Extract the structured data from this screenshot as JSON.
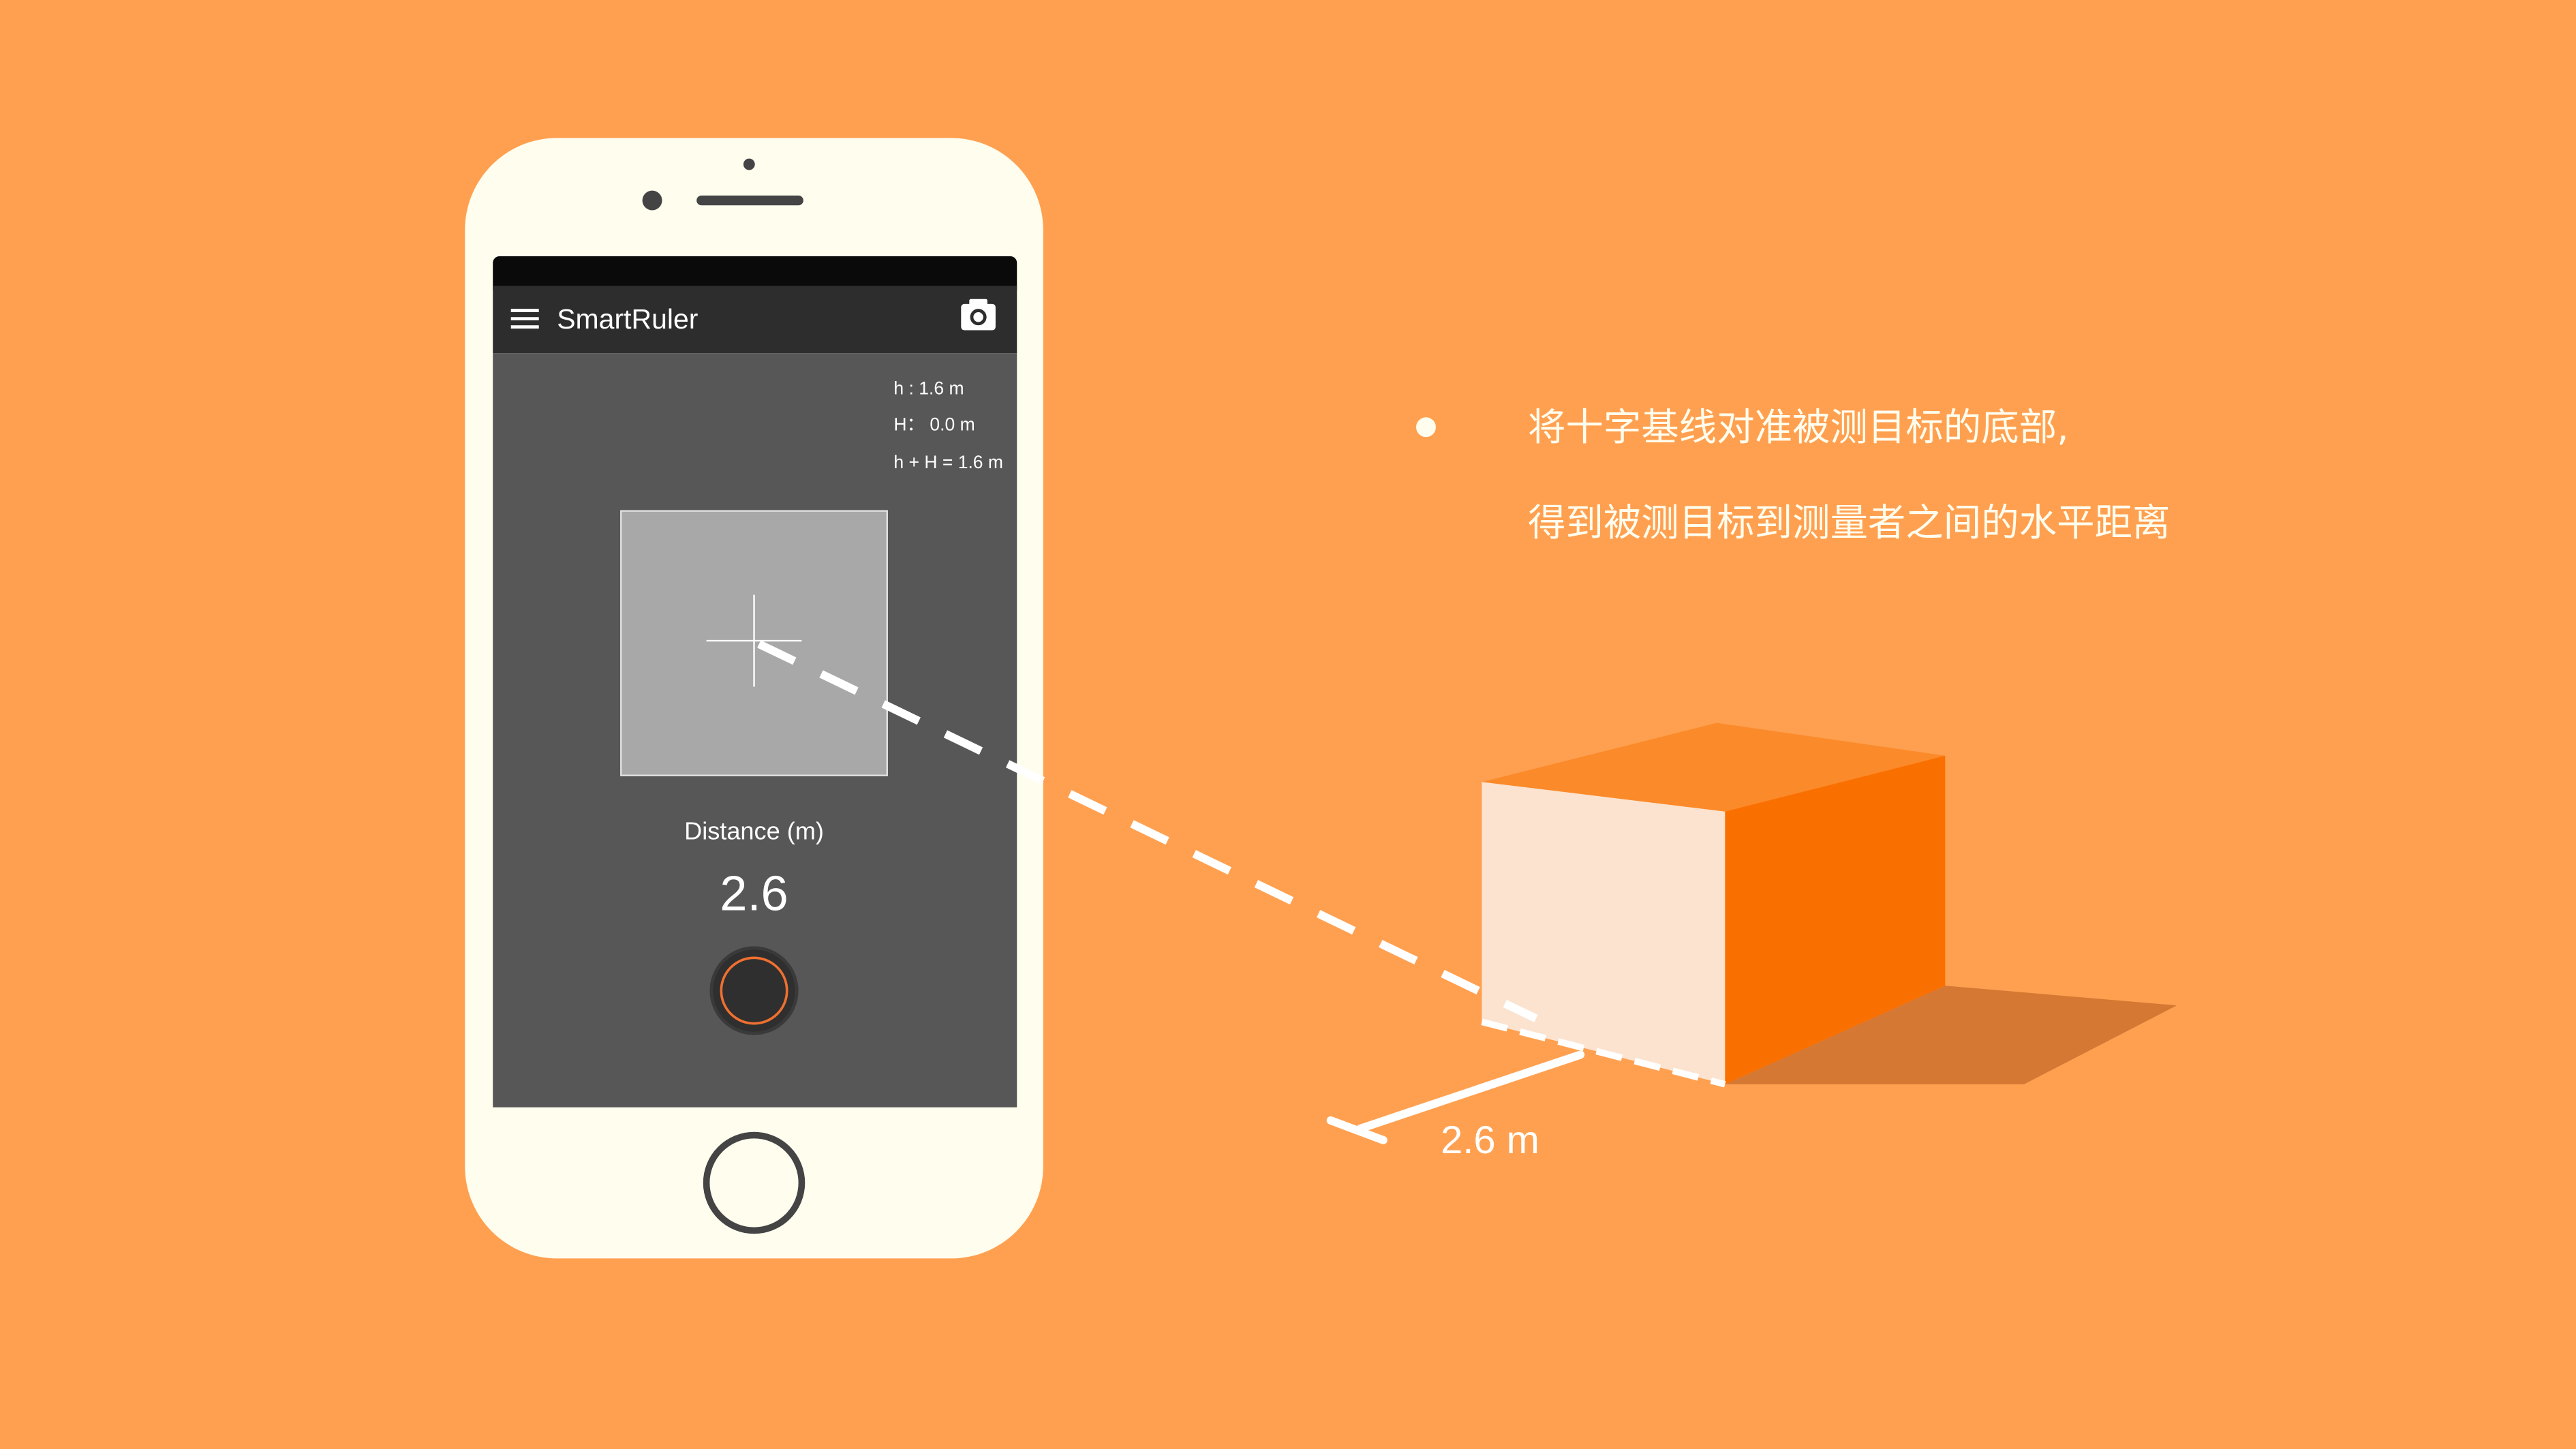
{
  "colors": {
    "background": "#FFA050",
    "phone_body": "#FFFDEE",
    "app_bar": "#2D2D2D",
    "screen": "#575757",
    "accent": "#F07030",
    "box_front": "#FCE3CF",
    "box_top": "#FB8A2A",
    "box_side": "#FA7000",
    "box_shadow": "#D47833"
  },
  "app": {
    "title": "SmartRuler",
    "menu_icon": "hamburger-icon",
    "camera_icon": "camera-icon"
  },
  "readouts": {
    "h": "h : 1.6 m",
    "H": "H： 0.0 m",
    "sum": "h + H = 1.6 m"
  },
  "distance": {
    "label": "Distance (m)",
    "value": "2.6"
  },
  "scene": {
    "measure_label": "2.6 m"
  },
  "annotation": {
    "line1": "将十字基线对准被测目标的底部,",
    "line2": "得到被测目标到测量者之间的水平距离"
  }
}
